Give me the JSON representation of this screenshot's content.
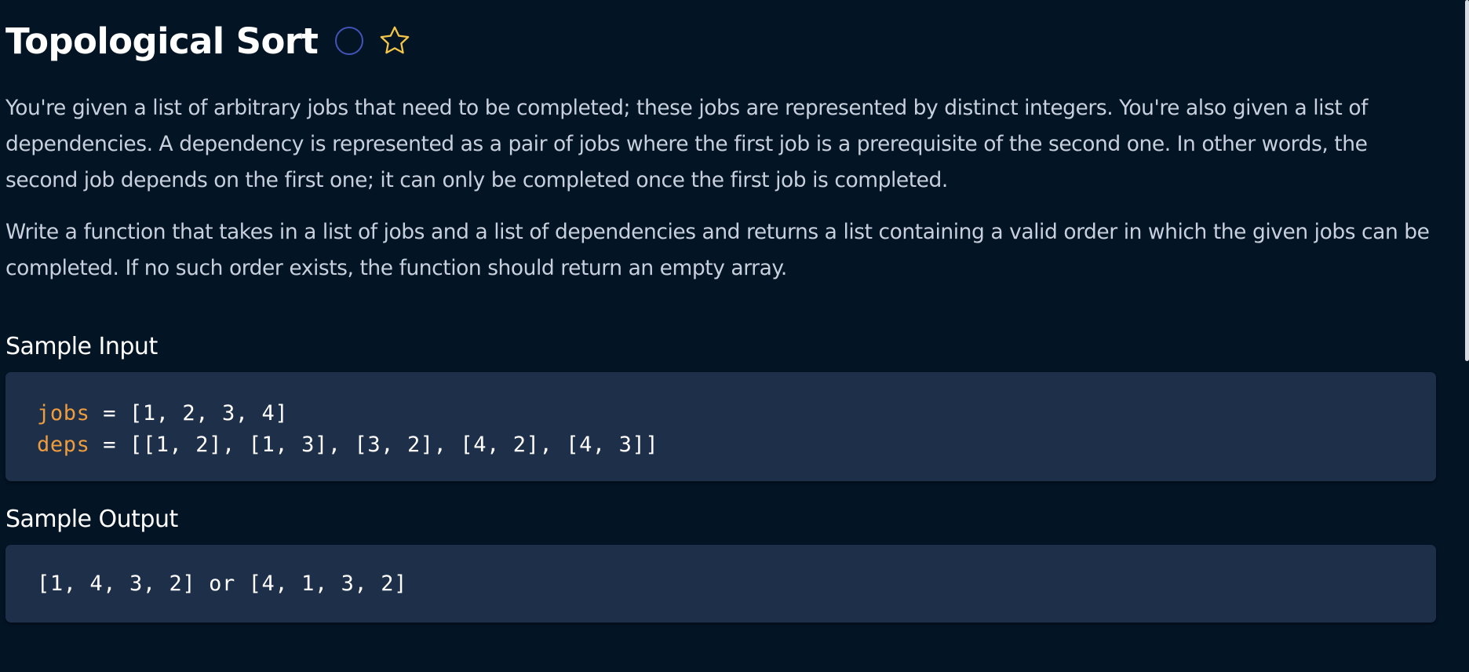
{
  "problem": {
    "title": "Topological Sort",
    "icons": {
      "status": "circle-icon",
      "favorite": "star-icon"
    },
    "colors": {
      "background": "#031425",
      "code_background": "#1e2f4a",
      "variable": "#ee9c3c",
      "status_circle": "#4254b8",
      "star": "#f3c64a"
    },
    "description": [
      "You're given a list of arbitrary jobs that need to be completed; these jobs are represented by distinct integers. You're also given a list of dependencies. A dependency is represented as a pair of jobs where the first job is a prerequisite of the second one. In other words, the second job depends on the first one; it can only be completed once the first job is completed.",
      "Write a function that takes in a list of jobs and a list of dependencies and returns a list containing a valid order in which the given jobs can be completed. If no such order exists, the function should return an empty array."
    ]
  },
  "sample_input": {
    "heading": "Sample Input",
    "lines": [
      {
        "var": "jobs",
        "value": " = [1, 2, 3, 4]"
      },
      {
        "var": "deps",
        "value": " = [[1, 2], [1, 3], [3, 2], [4, 2], [4, 3]]"
      }
    ]
  },
  "sample_output": {
    "heading": "Sample Output",
    "text": "[1, 4, 3, 2] or [4, 1, 3, 2]"
  }
}
